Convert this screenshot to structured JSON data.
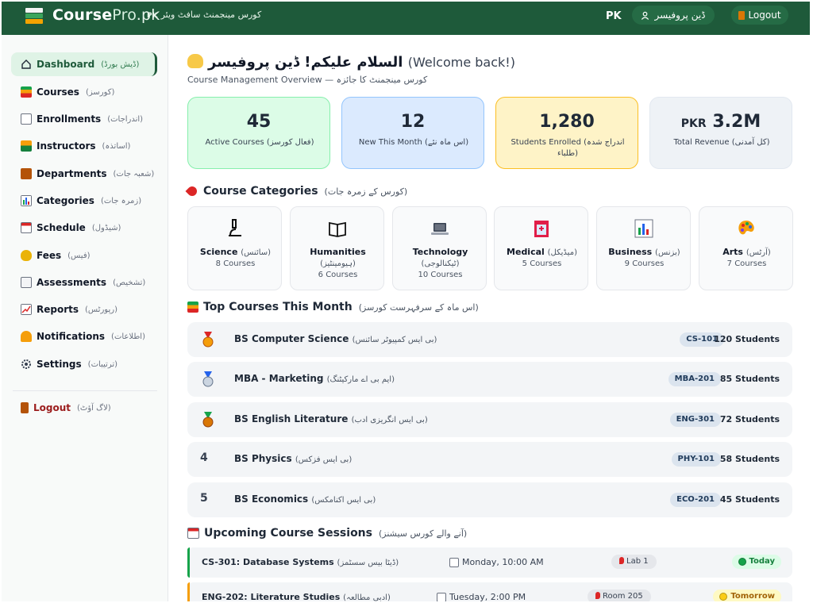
{
  "colors": {
    "brand": "#1e5a3a",
    "accent_green": "#16a34a",
    "accent_yellow": "#facc15",
    "danger": "#9b1c1c"
  },
  "topbar": {
    "brand_main": "Course",
    "brand_pro": "Pro",
    "brand_suffix": ".pk",
    "tagline_prefix": "PK",
    "tagline": "کورس مینجمنٹ سافٹ ویئر",
    "region": "PK",
    "user_name": "ڈین پروفیسر",
    "logout_label": "Logout"
  },
  "sidebar": {
    "items": [
      {
        "label": "Dashboard",
        "urdu": "(ڈیش بورڈ)",
        "icon": "home-icon"
      },
      {
        "label": "Courses",
        "urdu": "(کورسز)",
        "icon": "books-icon"
      },
      {
        "label": "Enrollments",
        "urdu": "(اندراجات)",
        "icon": "memo-icon"
      },
      {
        "label": "Instructors",
        "urdu": "(اساتذہ)",
        "icon": "teacher-icon"
      },
      {
        "label": "Departments",
        "urdu": "(شعبہ جات)",
        "icon": "building-icon"
      },
      {
        "label": "Categories",
        "urdu": "(زمرہ جات)",
        "icon": "chart-icon"
      },
      {
        "label": "Schedule",
        "urdu": "(شیڈول)",
        "icon": "calendar-icon"
      },
      {
        "label": "Fees",
        "urdu": "(فیس)",
        "icon": "money-bag-icon"
      },
      {
        "label": "Assessments",
        "urdu": "(تشخیص)",
        "icon": "clipboard-icon"
      },
      {
        "label": "Reports",
        "urdu": "(رپورٹس)",
        "icon": "trend-chart-icon"
      },
      {
        "label": "Notifications",
        "urdu": "(اطلاعات)",
        "icon": "bell-icon"
      },
      {
        "label": "Settings",
        "urdu": "(ترتیبات)",
        "icon": "gear-icon"
      }
    ],
    "logout": {
      "label": "Logout",
      "urdu": "(لاگ آؤٹ)",
      "icon": "book-icon"
    }
  },
  "welcome": {
    "greeting": "السلام علیکم! ڈین پروفیسر",
    "english": "(Welcome back!)",
    "subtitle": "Course Management Overview — کورس مینجمنٹ کا جائزہ"
  },
  "stats": [
    {
      "value": "45",
      "label": "Active Courses (فعال کورسز)"
    },
    {
      "value": "12",
      "label": "New This Month (اس ماہ نئے)"
    },
    {
      "value": "1,280",
      "label": "Students Enrolled (اندراج شدہ طلباء)"
    },
    {
      "currency": "PKR",
      "value": "3.2M",
      "label": "Total Revenue (کل آمدنی)"
    }
  ],
  "categories_section": {
    "title": "Course Categories",
    "urdu": "(کورس کے زمرہ جات)"
  },
  "categories": [
    {
      "name": "Science",
      "urdu": "(سائنس)",
      "count": "8 Courses",
      "icon": "microscope-icon"
    },
    {
      "name": "Humanities",
      "urdu": "(ہیومینٹیز)",
      "count": "6 Courses",
      "icon": "open-book-icon"
    },
    {
      "name": "Technology",
      "urdu": "(ٹیکنالوجی)",
      "count": "10 Courses",
      "icon": "laptop-icon"
    },
    {
      "name": "Medical",
      "urdu": "(میڈیکل)",
      "count": "5 Courses",
      "icon": "hospital-icon"
    },
    {
      "name": "Business",
      "urdu": "(بزنس)",
      "count": "9 Courses",
      "icon": "bar-chart-icon"
    },
    {
      "name": "Arts",
      "urdu": "(آرٹس)",
      "count": "7 Courses",
      "icon": "palette-icon"
    }
  ],
  "top_courses_section": {
    "title": "Top Courses This Month",
    "urdu": "(اس ماہ کے سرفہرست کورسز)"
  },
  "top_courses": [
    {
      "rank": "",
      "medal": "gold",
      "name": "BS Computer Science",
      "urdu": "(بی ایس کمپیوٹر سائنس)",
      "code": "CS-101",
      "students": "120 Students"
    },
    {
      "rank": "",
      "medal": "silver",
      "name": "MBA - Marketing",
      "urdu": "(ایم بی اے مارکیٹنگ)",
      "code": "MBA-201",
      "students": "85 Students"
    },
    {
      "rank": "",
      "medal": "bronze",
      "name": "BS English Literature",
      "urdu": "(بی ایس انگریزی ادب)",
      "code": "ENG-301",
      "students": "72 Students"
    },
    {
      "rank": "4",
      "medal": "",
      "name": "BS Physics",
      "urdu": "(بی ایس فزکس)",
      "code": "PHY-101",
      "students": "58 Students"
    },
    {
      "rank": "5",
      "medal": "",
      "name": "BS Economics",
      "urdu": "(بی ایس اکنامکس)",
      "code": "ECO-201",
      "students": "45 Students"
    }
  ],
  "sessions_section": {
    "title": "Upcoming Course Sessions",
    "urdu": "(آنے والے کورس سیشنز)"
  },
  "sessions": [
    {
      "title": "CS-301: Database Systems",
      "urdu": "(ڈیٹا بیس سسٹمز)",
      "time": "Monday, 10:00 AM",
      "room": "Lab 1",
      "status": "Today",
      "status_color": "#16a34a"
    },
    {
      "title": "ENG-202: Literature Studies",
      "urdu": "(ادبی مطالعہ)",
      "time": "Tuesday, 2:00 PM",
      "room": "Room 205",
      "status": "Tomorrow",
      "status_color": "#facc15"
    }
  ]
}
